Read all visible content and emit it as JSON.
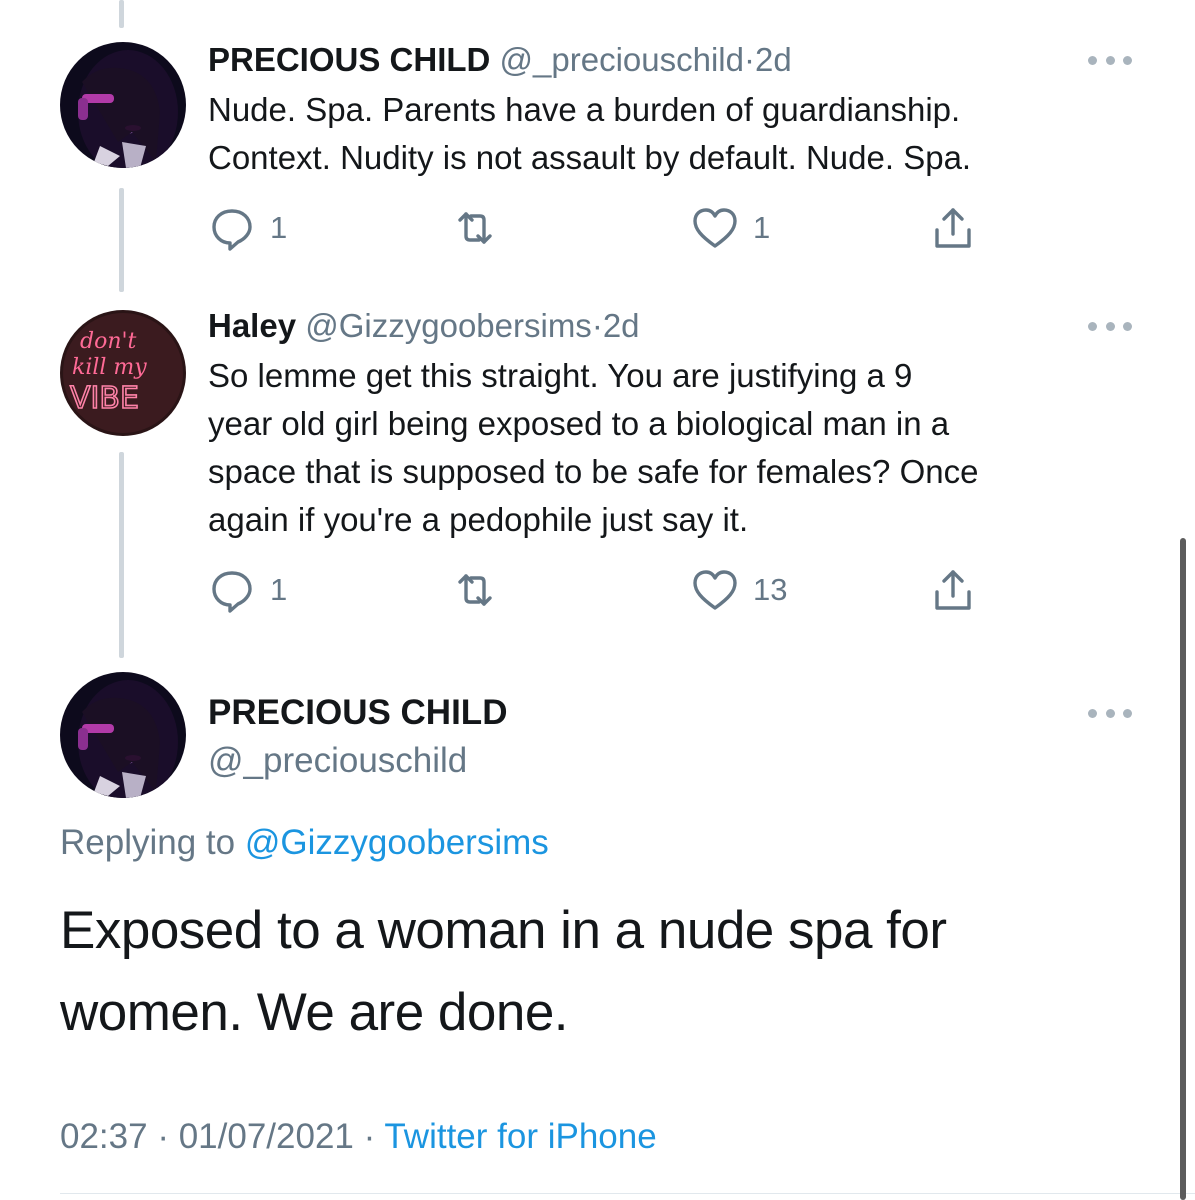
{
  "tweets": [
    {
      "name": "PRECIOUS CHILD",
      "handle": "@_preciouschild",
      "dot": "·",
      "age": "2d",
      "text_lines": [
        "Nude. Spa. Parents have a burden of guardianship.",
        "Context. Nudity is not assault by default. Nude. Spa."
      ],
      "reply_count": "1",
      "like_count": "1",
      "avatar_icon": "profile-photo-icon"
    },
    {
      "name": "Haley",
      "handle": "@Gizzygoobersims",
      "dot": "·",
      "age": "2d",
      "text_lines": [
        "So lemme get this straight. You are justifying a 9",
        "year old girl being exposed to a biological man in a",
        "space that is supposed to be safe for females? Once",
        "again if you're a pedophile just say it."
      ],
      "reply_count": "1",
      "like_count": "13",
      "avatar_lines": [
        "don't",
        "kill my",
        "VIBE"
      ]
    }
  ],
  "main_tweet": {
    "name": "PRECIOUS CHILD",
    "handle": "@_preciouschild",
    "replying_prefix": "Replying to ",
    "replying_to": "@Gizzygoobersims",
    "text_lines": [
      "Exposed to a woman in a nude spa for",
      "women. We are done."
    ],
    "time": "02:37",
    "sep1": " · ",
    "date": "01/07/2021",
    "sep2": " · ",
    "source": "Twitter for iPhone"
  },
  "colors": {
    "accent": "#1b95e0",
    "muted": "#657786",
    "text": "#14171a",
    "neon": "#ff4f8a"
  }
}
